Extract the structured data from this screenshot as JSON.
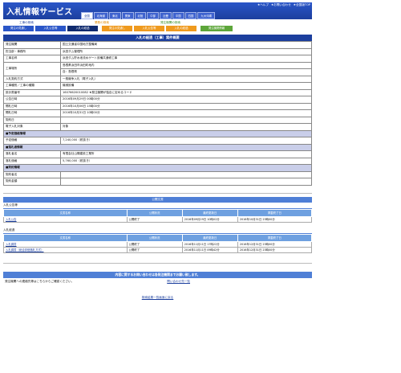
{
  "header": {
    "logo": "入札情報サービス",
    "topnav": [
      "★ヘルプ",
      "★お問い合わせ",
      "★全国版TOP"
    ],
    "regions": [
      "全国",
      "北海道",
      "東北",
      "関東",
      "北陸",
      "中部",
      "近畿",
      "中国",
      "四国",
      "九州沖縄"
    ]
  },
  "categories": {
    "construction": "工事の検索",
    "business": "業務の検索",
    "org": "発注機関の検索"
  },
  "tabs": [
    "発注の見通し",
    "入札公告等",
    "入札の経過",
    "発注の見通し",
    "入札公告等",
    "入札の経過",
    "発注機関情報"
  ],
  "detail": {
    "title": "入札の経過（工事）案件概要",
    "rows": [
      {
        "k": "発注機関",
        "v": "国土交通省中国地方整備局"
      },
      {
        "k": "担当部・事務所",
        "v": "浜田ダム管理所"
      },
      {
        "k": "工事名称",
        "v": "浜田ダム貯水池流水ゲート設備共通修工事"
      },
      {
        "k": "工事場所",
        "v": "島根県浜田市浜田町地内"
      },
      {
        "k": "",
        "v": "自：島根県"
      },
      {
        "k": "入札契約方式",
        "v": "一般競争入札（電子入札）"
      },
      {
        "k": "工事種別／工事の種類",
        "v": "機械設備"
      },
      {
        "k": "設計書番号",
        "v": "16076620010082      ★発注機関が独自に定めるコード"
      },
      {
        "k": "公告日時",
        "v": "2016年09月29日 00時00分"
      },
      {
        "k": "開札日時",
        "v": "2016年10月06日 15時00分"
      },
      {
        "k": "開札日時",
        "v": "2016年10月31日 10時00分"
      },
      {
        "k": "契約日",
        "v": ""
      },
      {
        "k": "電子入札対象",
        "v": "対象"
      }
    ],
    "g1": "■予定価格情報",
    "price_label": "予定価格",
    "price": "7,240,000（税抜き）",
    "g2": "■落札者情報",
    "winner_label": "落札者名",
    "winner": "有限会社山陽建設工業所",
    "win_price_label": "落札価格",
    "win_price": "5,760,000（税抜き）",
    "g3": "■契約情報",
    "contractor_label": "契約者名",
    "contract_amount_label": "契約金額"
  },
  "public_docs": {
    "title": "公開文書",
    "section1": "入札公告等",
    "headers": [
      "文書名称",
      "公開状況",
      "最終更新日",
      "掲載終了日"
    ],
    "rows1": [
      [
        "入札公告",
        "公開終了",
        "2016年09月29日 10時02分",
        "2016年10月31日 23時00分"
      ]
    ],
    "section2": "入札経過",
    "rows2": [
      [
        "入札調書",
        "公開終了",
        "2016年11月11日 17時22分",
        "2016年12月31日 23時00分"
      ],
      [
        "入札調書（総合評価落札方式）",
        "公開終了",
        "2016年11月11日 09時42分",
        "2016年12月31日 23時00分"
      ]
    ]
  },
  "notice": {
    "title": "内容に関するお問い合わせは各発注機関までお願い致します。",
    "text": "発注機関への連絡先等はこちらからご確認ください。",
    "link": "問い合わせ先一覧"
  },
  "back_link": "検索結果一覧画面に戻る"
}
